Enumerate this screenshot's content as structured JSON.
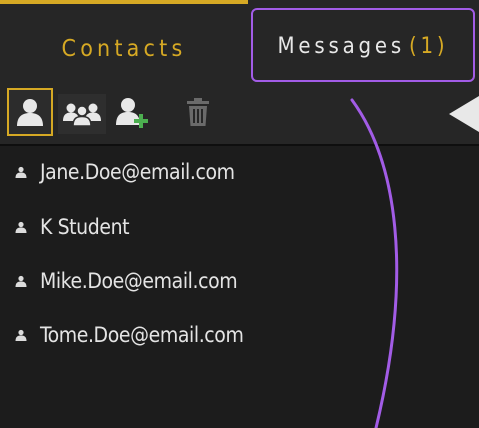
{
  "tabs": [
    {
      "label": "Contacts",
      "state": "active"
    },
    {
      "label": "Messages",
      "count": "(1)",
      "state": "highlighted"
    }
  ],
  "toolbar": {
    "buttons": [
      {
        "icon": "user-icon",
        "state": "selected"
      },
      {
        "icon": "group-icon"
      },
      {
        "icon": "add-user-icon"
      },
      {
        "icon": "trash-icon"
      }
    ],
    "collapse_icon": "triangle-left-icon"
  },
  "contacts": [
    {
      "name": "Jane.Doe@email.com"
    },
    {
      "name": "K Student"
    },
    {
      "name": "Mike.Doe@email.com"
    },
    {
      "name": "Tome.Doe@email.com"
    }
  ],
  "colors": {
    "background": "#1c1c1c",
    "panel": "#262626",
    "accent": "#d6a924",
    "highlight": "#a25ce6",
    "text": "#e4e4e4",
    "add": "#4caf50"
  }
}
